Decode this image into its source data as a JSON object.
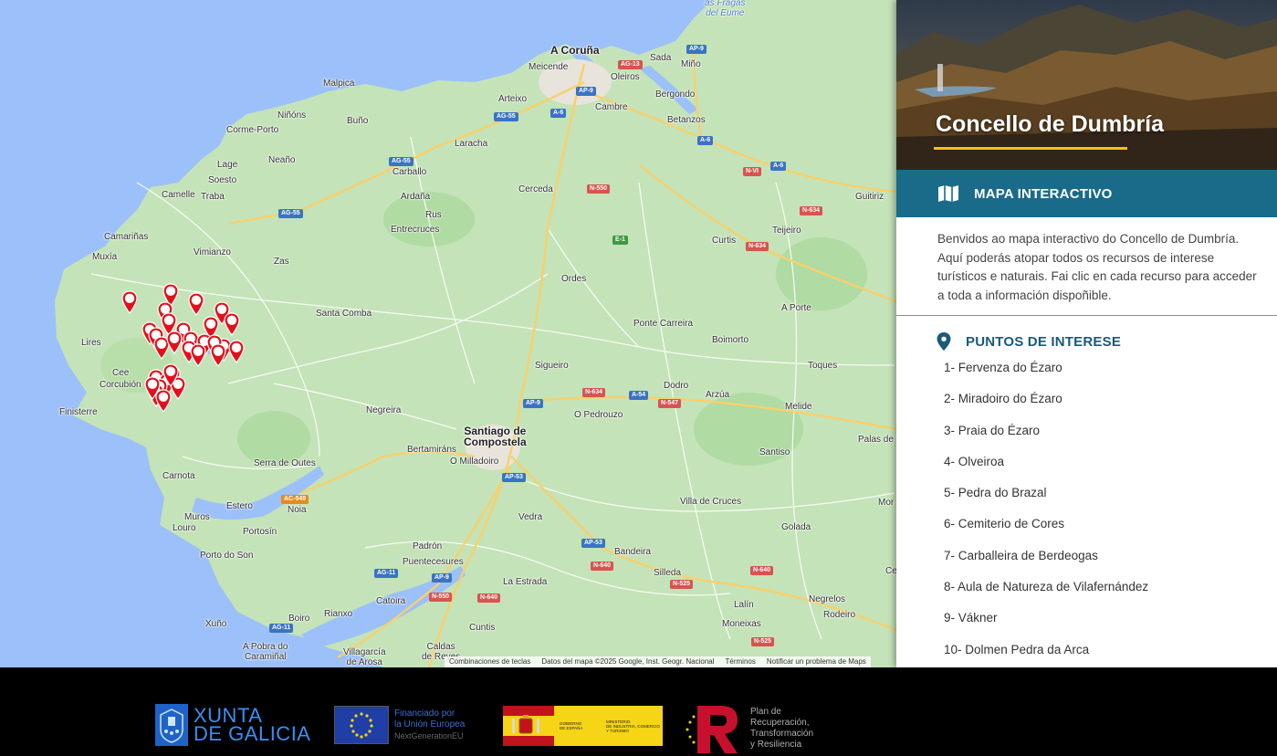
{
  "header": {
    "title": "Concello de Dumbría"
  },
  "section": {
    "label": "MAPA INTERACTIVO",
    "icon": "map-icon"
  },
  "intro": "Benvidos ao mapa interactivo do Concello de Dumbría. Aquí poderás atopar todos os recursos de interese turísticos e naturais. Fai clic en cada recurso para acceder a toda a información dispoñible.",
  "points_of_interest": {
    "title": "PUNTOS DE INTERESE",
    "icon": "location-pin-icon",
    "items": [
      "1- Fervenza do Ézaro",
      "2- Miradoiro do Ézaro",
      "3- Praia do Ézaro",
      "4- Olveiroa",
      "5- Pedra do Brazal",
      "6- Cemiterio de Cores",
      "7- Carballeira de Berdeogas",
      "8- Aula de Natureza de Vilafernández",
      "9- Vákner",
      "10- Dolmen Pedra da Arca"
    ]
  },
  "map": {
    "places": {
      "fragas": "as Fragas\ndel Eume",
      "acoruna": "A Coruña",
      "meicende": "Meicende",
      "oleiros": "Oleiros",
      "sada": "Sada",
      "mino": "Miño",
      "bergondo": "Bergondo",
      "malpica": "Malpica",
      "arteixo": "Arteixo",
      "cambre": "Cambre",
      "ninons": "Niñóns",
      "buno": "Buño",
      "corme": "Corme-Porto",
      "betanzos": "Betanzos",
      "laracha": "Laracha",
      "lage": "Lage",
      "neano": "Neaño",
      "soesto": "Soesto",
      "carballo": "Carballo",
      "camelle": "Camelle",
      "traba": "Traba",
      "cerceda": "Cerceda",
      "ardana": "Ardaña",
      "guitiriz": "Guitiriz",
      "rus": "Rus",
      "entrecruces": "Entrecruces",
      "teijeiro": "Teijeiro",
      "camarinas": "Camariñas",
      "curtis": "Curtis",
      "muxia": "Muxía",
      "vimianzo": "Vimianzo",
      "zas": "Zas",
      "ordes": "Ordes",
      "santacomba": "Santa Comba",
      "aporte": "A Porte",
      "pontecarreira": "Ponte Carreira",
      "lires": "Lires",
      "boimorto": "Boimorto",
      "sigueiro": "Sigueiro",
      "toques": "Toques",
      "cee": "Cee",
      "corcubion": "Corcubión",
      "dodro": "Dodro",
      "arzua": "Arzúa",
      "finisterre": "Finisterre",
      "negreira": "Negreira",
      "opedrouzo": "O Pedrouzo",
      "melide": "Melide",
      "santiago": "Santiago de\nCompostela",
      "palas": "Palas de",
      "bertamirans": "Bertamiráns",
      "omilladoiro": "O Milladoiro",
      "santiso": "Santiso",
      "serraoutes": "Serra de Outes",
      "carnota": "Carnota",
      "estero": "Estero",
      "noia": "Noia",
      "villacruces": "Villa de Cruces",
      "mor": "Mor",
      "muros": "Muros",
      "louro": "Louro",
      "portosin": "Portosín",
      "vedra": "Vedra",
      "golada": "Golada",
      "portoson": "Porto do Son",
      "padron": "Padrón",
      "puentecesures": "Puentecesures",
      "bandeira": "Bandeira",
      "laestrada": "La Estrada",
      "silleda": "Silleda",
      "ce": "Ce",
      "catoira": "Catoira",
      "lalin": "Lalín",
      "negrelos": "Negrelos",
      "rodeiro": "Rodeiro",
      "boiro": "Boiro",
      "rianxo": "Rianxo",
      "xuno": "Xuño",
      "cuntis": "Cuntis",
      "moneixas": "Moneixas",
      "apobra": "A Pobra do\nCaramiñal",
      "villagarcia": "Villagarcía\nde Arosa",
      "caldas": "Caldas\nde Reyes"
    },
    "roads": [
      "AP-9",
      "AG-13",
      "AP-9",
      "AG-55",
      "A-6",
      "AG-55",
      "A-6",
      "N-VI",
      "A-6",
      "N-550",
      "AG-55",
      "N-634",
      "E-1",
      "N-634",
      "N-634",
      "AP-9",
      "A-54",
      "N-547",
      "AP-53",
      "AC-549",
      "AP-53",
      "N-640",
      "N-525",
      "N-640",
      "AG-11",
      "AP-9",
      "N-550",
      "N-640",
      "AG-11",
      "N-525"
    ],
    "attribution": [
      "Combinaciones de teclas",
      "Datos del mapa ©2025 Google, Inst. Geogr. Nacional",
      "Términos",
      "Notificar un problema de Maps"
    ],
    "marker_color": "#e3101b",
    "marker_count": 30
  },
  "footer": {
    "xunta": "XUNTA\nDE GALICIA",
    "eu_line1": "Financiado por",
    "eu_line2": "la Unión Europea",
    "eu_line3": "NextGenerationEU",
    "spain_gov": "GOBIERNO\nDE ESPAÑA",
    "spain_ministry": "MINISTERIO\nDE INDUSTRIA, COMERCIO\nY TURISMO",
    "prtr": "Plan de\nRecuperación,\nTransformación\ny Resiliencia"
  },
  "colors": {
    "accent": "#1a6b8a",
    "title_underline": "#f2c313",
    "poi_heading": "#1a5a7a",
    "marker": "#e3101b",
    "land": "#c4e3b8",
    "sea": "#9cc0f9"
  }
}
